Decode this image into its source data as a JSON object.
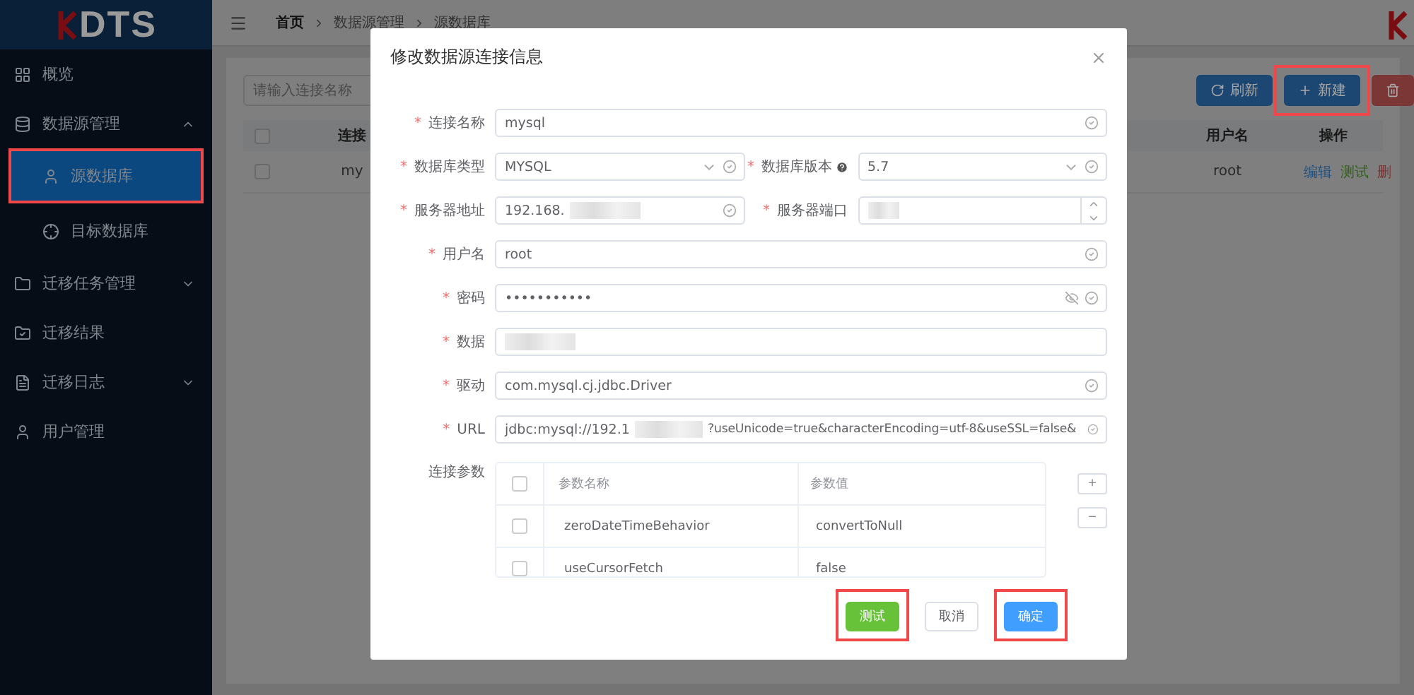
{
  "sidebar": {
    "logo": "DTS",
    "items": [
      {
        "label": "概览",
        "selected": false
      },
      {
        "label": "数据源管理",
        "expanded": true,
        "selected": false,
        "children": [
          {
            "label": "源数据库",
            "selected": true,
            "highlighted": true
          },
          {
            "label": "目标数据库",
            "selected": false,
            "highlighted": false
          }
        ]
      },
      {
        "label": "迁移任务管理",
        "expanded": false,
        "selected": false
      },
      {
        "label": "迁移结果",
        "selected": false
      },
      {
        "label": "迁移日志",
        "expanded": false,
        "selected": false
      },
      {
        "label": "用户管理",
        "selected": false
      }
    ]
  },
  "breadcrumb": [
    "首页",
    "数据源管理",
    "源数据库"
  ],
  "background": {
    "search": {
      "placeholder": "请输入连接名称"
    },
    "buttons": [
      {
        "label": "刷新",
        "kind": "refresh",
        "highlighted": false
      },
      {
        "label": "新建",
        "kind": "add",
        "highlighted": true
      },
      {
        "kind": "delete",
        "highlighted": false
      }
    ],
    "table": {
      "all_selected": false,
      "columns": [
        "连接",
        "用户名",
        "操作"
      ],
      "rows": [
        {
          "selected": false,
          "cells": [
            "my",
            "root"
          ],
          "actions": [
            {
              "label": "编辑",
              "color": "#20507f"
            },
            {
              "label": "测试",
              "color": "#34611d"
            },
            {
              "label": "删",
              "color": "#7b3636"
            }
          ]
        }
      ]
    }
  },
  "dialog": {
    "title": "修改数据源连接信息",
    "rows": [
      [
        {
          "label": "连接名称",
          "mark": "*",
          "kind": "text",
          "value": "mysql",
          "valid": true
        }
      ],
      [
        {
          "label": "数据库类型",
          "mark": "*",
          "kind": "select",
          "value": "MYSQL",
          "valid": true
        },
        {
          "label": "数据库版本",
          "mark": "*",
          "kind": "select",
          "value": "5.7",
          "valid": true,
          "help": true
        }
      ],
      [
        {
          "label": "服务器地址",
          "mark": "*",
          "kind": "text",
          "value": "192.168.",
          "valid": true,
          "redacted": true
        },
        {
          "label": "服务器端口",
          "mark": "*",
          "kind": "number",
          "redacted": true
        }
      ],
      [
        {
          "label": "用户名",
          "mark": "*",
          "kind": "text",
          "value": "root",
          "valid": true
        }
      ],
      [
        {
          "label": "密码",
          "mark": "*",
          "kind": "password",
          "value": "•••••••••••",
          "valid": true
        }
      ],
      [
        {
          "label": "数据",
          "mark": "*",
          "kind": "text",
          "redacted": true
        }
      ],
      [
        {
          "label": "驱动",
          "mark": "*",
          "kind": "text",
          "value": "com.mysql.cj.jdbc.Driver",
          "valid": true
        }
      ],
      [
        {
          "label": "URL",
          "mark": "*",
          "kind": "url",
          "value": "jdbc:mysql://192.1",
          "value_end": "?useUnicode=true&characterEncoding=utf-8&useSSL=false&",
          "valid": true,
          "redacted": true
        }
      ]
    ],
    "params": {
      "label": "连接参数",
      "all_checked": false,
      "columns": [
        "参数名称",
        "参数值"
      ],
      "rows": [
        {
          "checked": false,
          "name": "zeroDateTimeBehavior",
          "value": "convertToNull"
        },
        {
          "checked": false,
          "name": "useCursorFetch",
          "value": "false"
        }
      ],
      "add": "+",
      "remove": "−"
    },
    "buttons": [
      {
        "label": "测试",
        "kind": "success",
        "highlighted": true
      },
      {
        "label": "取消",
        "kind": "default",
        "highlighted": false
      },
      {
        "label": "确定",
        "kind": "primary",
        "highlighted": true
      }
    ]
  }
}
